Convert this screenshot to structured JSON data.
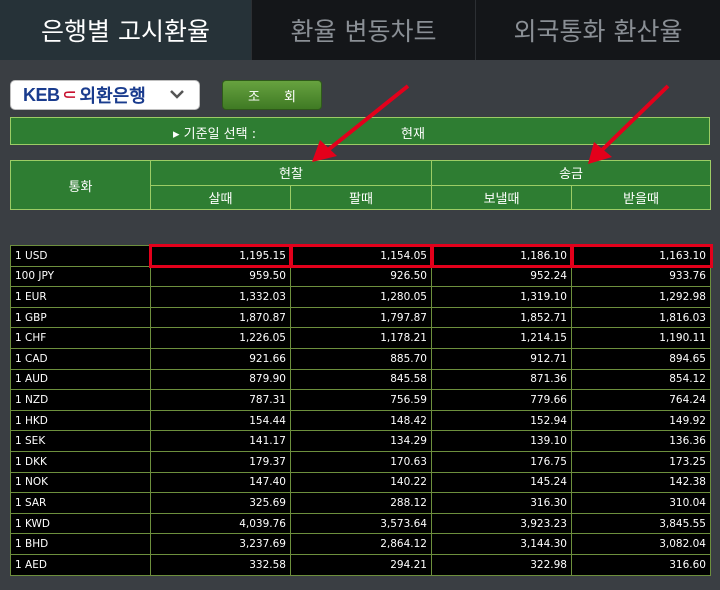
{
  "tabs": [
    {
      "label": "은행별 고시환율",
      "active": true
    },
    {
      "label": "환율 변동차트",
      "active": false
    },
    {
      "label": "외국통화 환산율",
      "active": false
    }
  ],
  "bank_selector": {
    "logo": "KEB",
    "name": "외환은행",
    "icon": "chevron-down-icon"
  },
  "query_button": "조 회",
  "date_bar": {
    "label": "▸ 기준일 선택 :",
    "value": "현재"
  },
  "headers": {
    "currency": "통화",
    "cash": "현찰",
    "transfer": "송금",
    "cash_buy": "살때",
    "cash_sell": "팔때",
    "send": "보낼때",
    "receive": "받을때"
  },
  "rows": [
    {
      "currency": "1 USD",
      "cash_buy": "1,195.15",
      "cash_sell": "1,154.05",
      "send": "1,186.10",
      "receive": "1,163.10"
    },
    {
      "currency": "100 JPY",
      "cash_buy": "959.50",
      "cash_sell": "926.50",
      "send": "952.24",
      "receive": "933.76"
    },
    {
      "currency": "1 EUR",
      "cash_buy": "1,332.03",
      "cash_sell": "1,280.05",
      "send": "1,319.10",
      "receive": "1,292.98"
    },
    {
      "currency": "1 GBP",
      "cash_buy": "1,870.87",
      "cash_sell": "1,797.87",
      "send": "1,852.71",
      "receive": "1,816.03"
    },
    {
      "currency": "1 CHF",
      "cash_buy": "1,226.05",
      "cash_sell": "1,178.21",
      "send": "1,214.15",
      "receive": "1,190.11"
    },
    {
      "currency": "1 CAD",
      "cash_buy": "921.66",
      "cash_sell": "885.70",
      "send": "912.71",
      "receive": "894.65"
    },
    {
      "currency": "1 AUD",
      "cash_buy": "879.90",
      "cash_sell": "845.58",
      "send": "871.36",
      "receive": "854.12"
    },
    {
      "currency": "1 NZD",
      "cash_buy": "787.31",
      "cash_sell": "756.59",
      "send": "779.66",
      "receive": "764.24"
    },
    {
      "currency": "1 HKD",
      "cash_buy": "154.44",
      "cash_sell": "148.42",
      "send": "152.94",
      "receive": "149.92"
    },
    {
      "currency": "1 SEK",
      "cash_buy": "141.17",
      "cash_sell": "134.29",
      "send": "139.10",
      "receive": "136.36"
    },
    {
      "currency": "1 DKK",
      "cash_buy": "179.37",
      "cash_sell": "170.63",
      "send": "176.75",
      "receive": "173.25"
    },
    {
      "currency": "1 NOK",
      "cash_buy": "147.40",
      "cash_sell": "140.22",
      "send": "145.24",
      "receive": "142.38"
    },
    {
      "currency": "1 SAR",
      "cash_buy": "325.69",
      "cash_sell": "288.12",
      "send": "316.30",
      "receive": "310.04"
    },
    {
      "currency": "1 KWD",
      "cash_buy": "4,039.76",
      "cash_sell": "3,573.64",
      "send": "3,923.23",
      "receive": "3,845.55"
    },
    {
      "currency": "1 BHD",
      "cash_buy": "3,237.69",
      "cash_sell": "2,864.12",
      "send": "3,144.30",
      "receive": "3,082.04"
    },
    {
      "currency": "1 AED",
      "cash_buy": "332.58",
      "cash_sell": "294.21",
      "send": "322.98",
      "receive": "316.60"
    }
  ],
  "highlight_color": "#e3001b",
  "header_color": "#2e7d32"
}
